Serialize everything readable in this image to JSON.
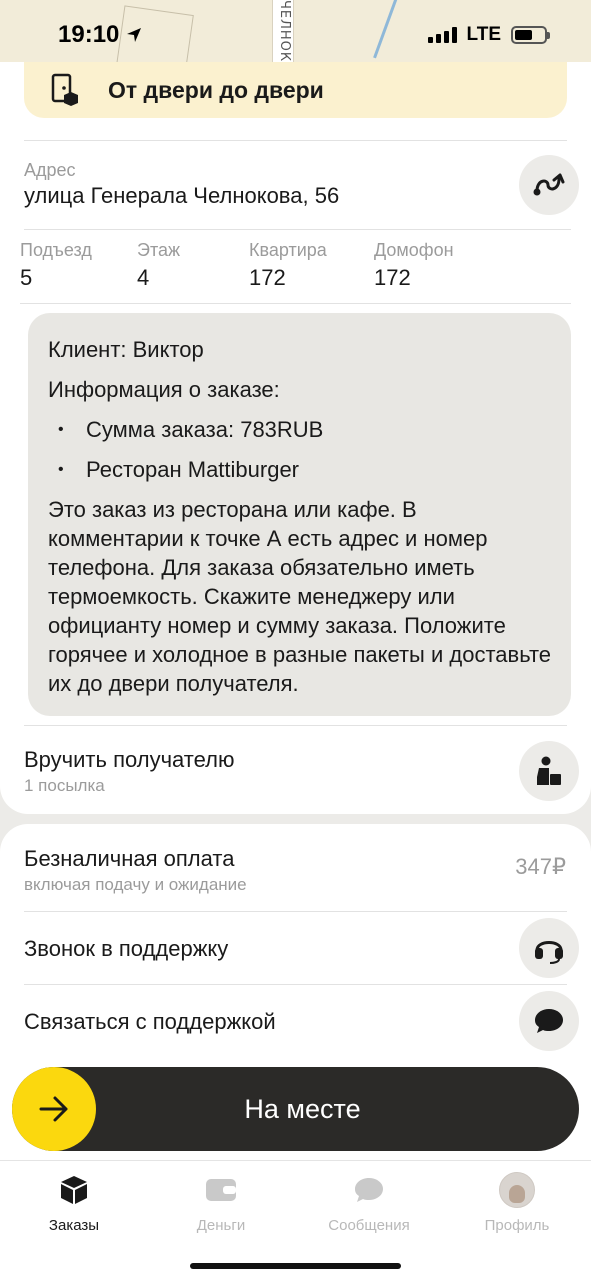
{
  "status_bar": {
    "time": "19:10",
    "network": "LTE"
  },
  "map": {
    "street_label": "ЧЕЛНОК"
  },
  "delivery_type": {
    "label": "От двери до двери"
  },
  "address": {
    "label": "Адрес",
    "value": "улица Генерала Челнокова, 56"
  },
  "details": [
    {
      "label": "Подъезд",
      "value": "5"
    },
    {
      "label": "Этаж",
      "value": "4"
    },
    {
      "label": "Квартира",
      "value": "172"
    },
    {
      "label": "Домофон",
      "value": "172"
    }
  ],
  "comment": {
    "client": "Клиент: Виктор",
    "info_title": "Информация о заказе:",
    "items": [
      "Сумма заказа: 783RUB",
      "Ресторан Mattiburger"
    ],
    "body": "Это заказ из ресторана или кафе. В комментарии к точке А есть адрес и номер телефона. Для заказа обязательно иметь термоемкость. Скажите менеджеру или официанту номер и сумму заказа. Положите горячее и холодное в разные пакеты и доставьте их до двери получателя."
  },
  "handover": {
    "title": "Вручить получателю",
    "subtitle": "1 посылка"
  },
  "payment": {
    "title": "Безналичная оплата",
    "subtitle": "включая подачу и ожидание",
    "amount": "347₽"
  },
  "support": {
    "call": "Звонок в поддержку",
    "chat": "Связаться с поддержкой"
  },
  "slider": {
    "label": "На месте"
  },
  "tabs": [
    {
      "label": "Заказы",
      "icon": "orders-box-icon",
      "active": true
    },
    {
      "label": "Деньги",
      "icon": "wallet-icon",
      "active": false
    },
    {
      "label": "Сообщения",
      "icon": "chat-bubble-icon",
      "active": false
    },
    {
      "label": "Профиль",
      "icon": "avatar",
      "active": false
    }
  ],
  "colors": {
    "accent": "#fbd80e",
    "banner": "#fbf1cf",
    "slider_bg": "#2b2a28",
    "muted_text": "#9b9b9b"
  }
}
